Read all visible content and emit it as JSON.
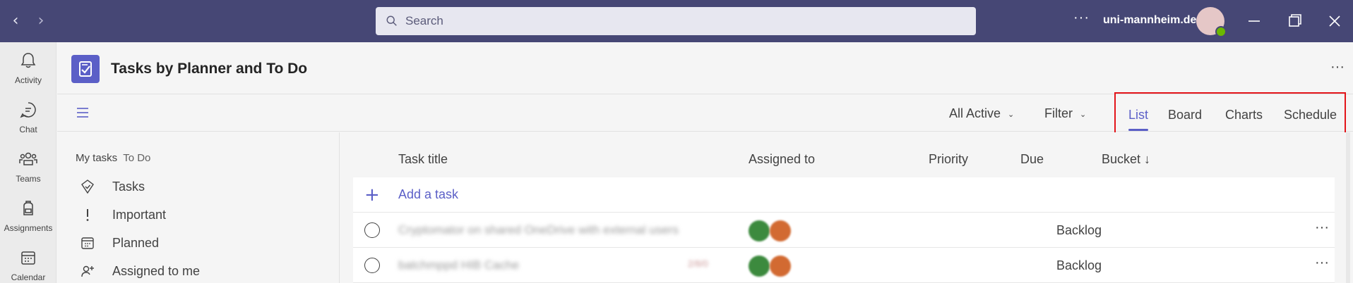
{
  "titlebar": {
    "search_placeholder": "Search",
    "more": "···",
    "org": "uni-mannheim.de",
    "avatar_status_color": "#6bb700"
  },
  "rail": {
    "items": [
      {
        "label": "Activity",
        "icon": "bell-icon"
      },
      {
        "label": "Chat",
        "icon": "chat-icon"
      },
      {
        "label": "Teams",
        "icon": "teams-icon"
      },
      {
        "label": "Assignments",
        "icon": "backpack-icon"
      },
      {
        "label": "Calendar",
        "icon": "calendar-icon"
      }
    ]
  },
  "app": {
    "title": "Tasks by Planner and To Do",
    "more": "···",
    "accent": "#5b5fc7"
  },
  "toolbar": {
    "filter_active": "All Active",
    "filter": "Filter",
    "tabs": [
      "List",
      "Board",
      "Charts",
      "Schedule"
    ],
    "active_tab": "List",
    "highlight_color": "#e3151a"
  },
  "sidebar": {
    "header": "My tasks",
    "header_sub": "To Do",
    "items": [
      {
        "label": "Tasks",
        "icon": "tasks-icon"
      },
      {
        "label": "Important",
        "icon": "exclamation-icon"
      },
      {
        "label": "Planned",
        "icon": "calendar-icon"
      },
      {
        "label": "Assigned to me",
        "icon": "person-add-icon"
      }
    ]
  },
  "list": {
    "columns": [
      "Task title",
      "Assigned to",
      "Priority",
      "Due",
      "Bucket ↓"
    ],
    "add_task": "Add a task",
    "rows": [
      {
        "title": "Cryptomator on shared OneDrive with external users",
        "tag": "",
        "bucket": "Backlog",
        "more": "···"
      },
      {
        "title": "batchmppd HIB Cache",
        "tag": "2/8/0",
        "bucket": "Backlog",
        "more": "···"
      }
    ]
  }
}
